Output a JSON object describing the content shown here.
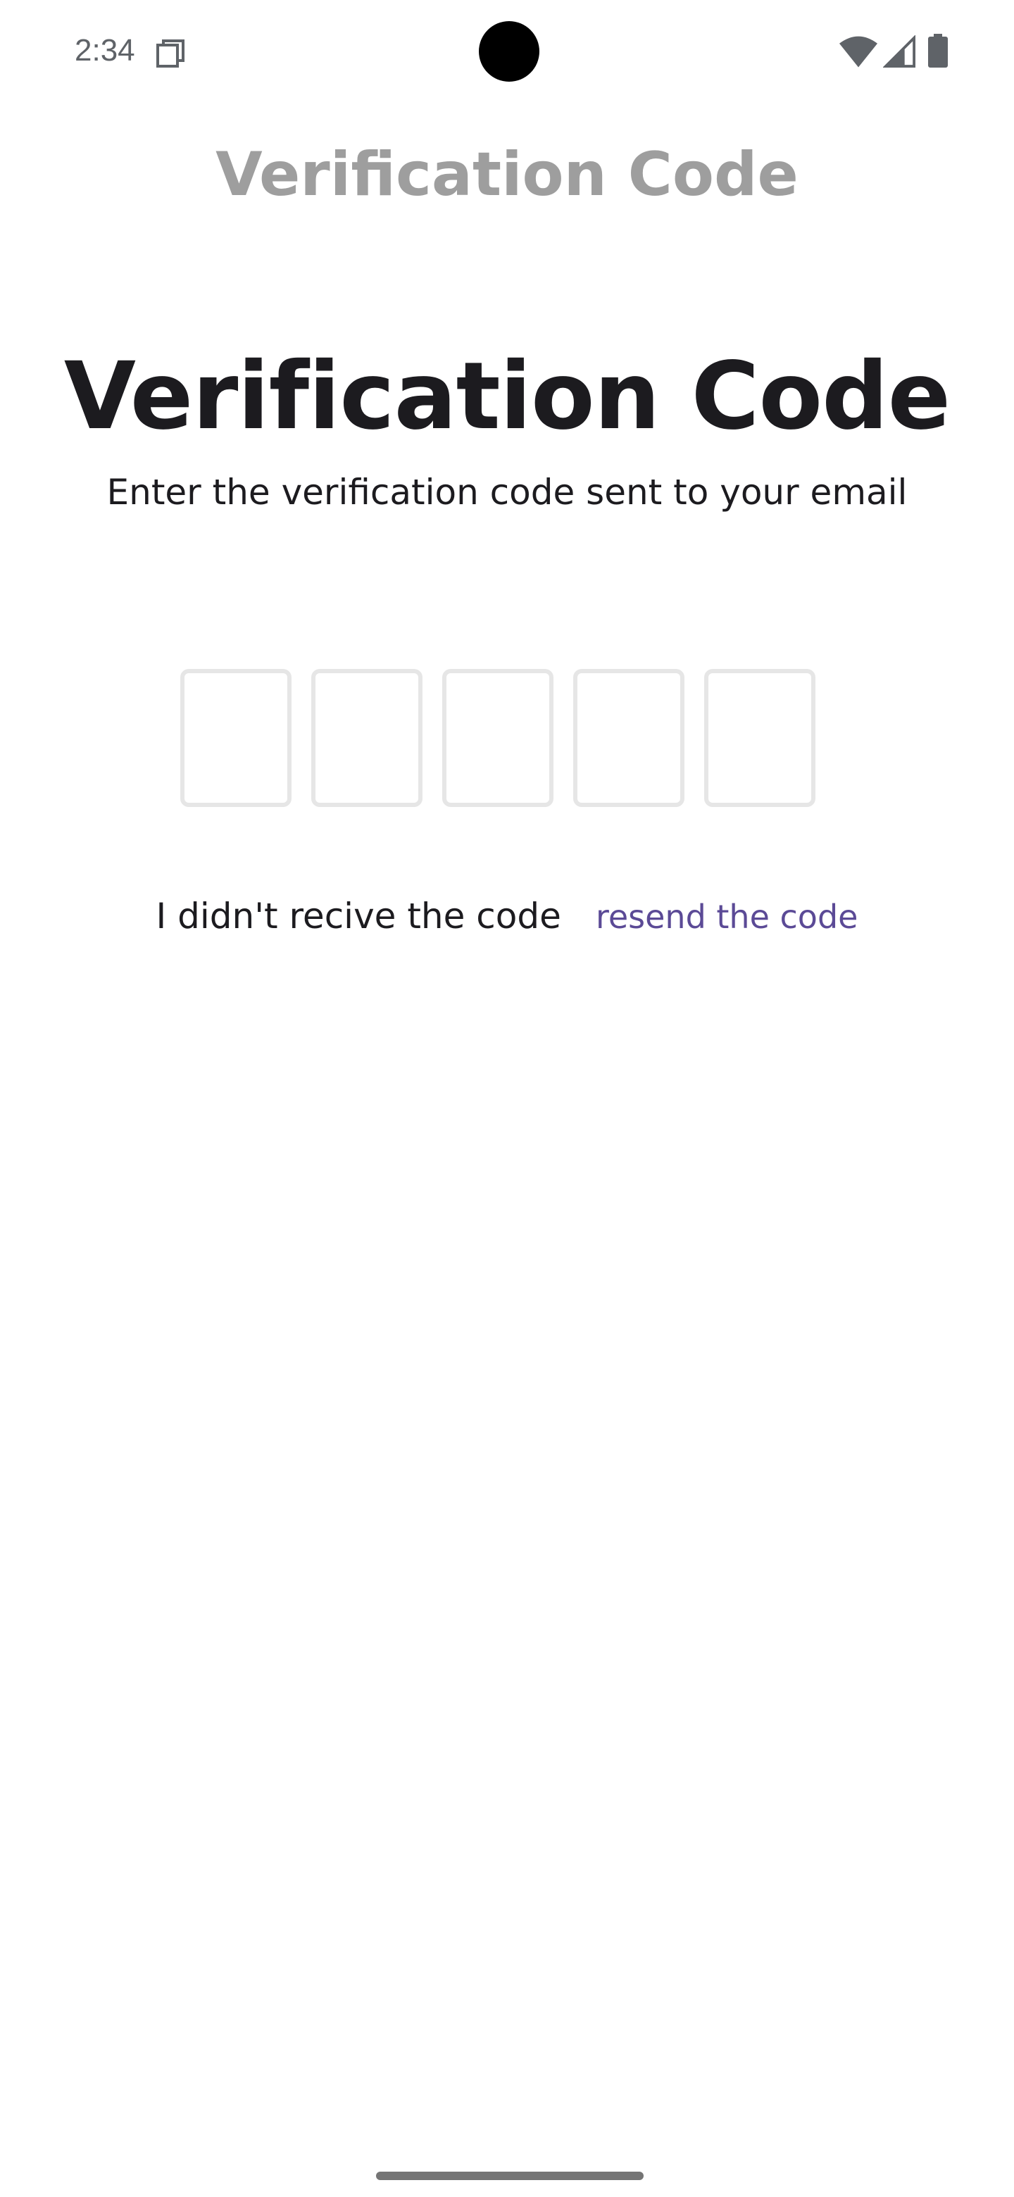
{
  "status_bar": {
    "time": "2:34",
    "icons": [
      "screen-record-icon",
      "wifi-icon",
      "signal-icon",
      "battery-icon"
    ]
  },
  "app_bar": {
    "title": "Verification Code"
  },
  "content": {
    "heading": "Verification Code",
    "subheading": "Enter the verification code sent to your email",
    "code_inputs": [
      "",
      "",
      "",
      "",
      ""
    ],
    "no_code_text": "I didn't recive the code",
    "resend_label": "resend the code"
  },
  "colors": {
    "app_bar_title": "#9e9e9e",
    "heading": "#1c1b1f",
    "input_border": "#e6e6e6",
    "link": "#5b4a96"
  }
}
